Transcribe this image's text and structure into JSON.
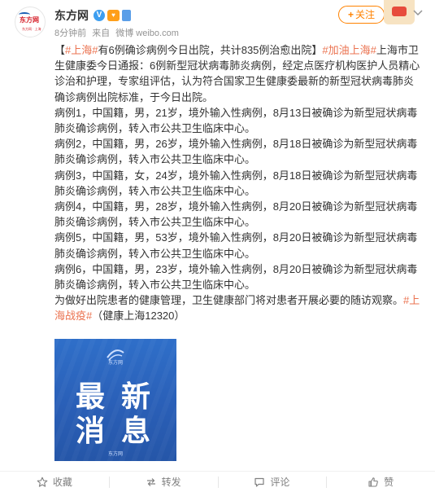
{
  "header": {
    "user_name": "东方网",
    "logo_text": "东方网",
    "logo_sub": "东方网 · 上海",
    "verified_glyph": "V",
    "timestamp": "8分钟前",
    "source_prefix": "来自",
    "source": "微博 weibo.com",
    "follow_label": "关注",
    "more_icon": "chevron-down-icon"
  },
  "post": {
    "paragraphs": [
      {
        "parts": [
          {
            "text": "【",
            "type": "text"
          },
          {
            "text": "#上海#",
            "type": "hashtag"
          },
          {
            "text": "有6例确诊病例今日出院，共计835例治愈出院】",
            "type": "text"
          },
          {
            "text": "#加油上海#",
            "type": "hashtag"
          },
          {
            "text": "上海市卫生健康委今日通报：6例新型冠状病毒肺炎病例，经定点医疗机构医护人员精心诊治和护理，专家组评估，认为符合国家卫生健康委最新的新型冠状病毒肺炎确诊病例出院标准，于今日出院。",
            "type": "text"
          }
        ]
      },
      {
        "parts": [
          {
            "text": "病例1，中国籍，男，21岁，境外输入性病例，8月13日被确诊为新型冠状病毒肺炎确诊病例，转入市公共卫生临床中心。",
            "type": "text"
          }
        ]
      },
      {
        "parts": [
          {
            "text": "病例2，中国籍，男，26岁，境外输入性病例，8月18日被确诊为新型冠状病毒肺炎确诊病例，转入市公共卫生临床中心。",
            "type": "text"
          }
        ]
      },
      {
        "parts": [
          {
            "text": "病例3，中国籍，女，24岁，境外输入性病例，8月18日被确诊为新型冠状病毒肺炎确诊病例，转入市公共卫生临床中心。",
            "type": "text"
          }
        ]
      },
      {
        "parts": [
          {
            "text": "病例4，中国籍，男，28岁，境外输入性病例，8月20日被确诊为新型冠状病毒肺炎确诊病例，转入市公共卫生临床中心。",
            "type": "text"
          }
        ]
      },
      {
        "parts": [
          {
            "text": "病例5，中国籍，男，53岁，境外输入性病例，8月20日被确诊为新型冠状病毒肺炎确诊病例，转入市公共卫生临床中心。",
            "type": "text"
          }
        ]
      },
      {
        "parts": [
          {
            "text": "病例6，中国籍，男，23岁，境外输入性病例，8月20日被确诊为新型冠状病毒肺炎确诊病例，转入市公共卫生临床中心。",
            "type": "text"
          }
        ]
      },
      {
        "parts": [
          {
            "text": "为做好出院患者的健康管理，卫生健康部门将对患者开展必要的随访观察。",
            "type": "text"
          },
          {
            "text": "#上海战疫#",
            "type": "hashtag"
          },
          {
            "text": "（健康上海12320）",
            "type": "text"
          }
        ]
      }
    ]
  },
  "image": {
    "chars": [
      "最",
      "新",
      "消",
      "息"
    ],
    "logo_text": "东方网",
    "footer": "东方网"
  },
  "actions": [
    {
      "label": "收藏",
      "icon": "star-icon",
      "name": "favorite-button"
    },
    {
      "label": "转发",
      "icon": "repost-icon",
      "name": "repost-button"
    },
    {
      "label": "评论",
      "icon": "comment-icon",
      "name": "comment-button"
    },
    {
      "label": "赞",
      "icon": "thumbs-up-icon",
      "name": "like-button"
    }
  ],
  "colors": {
    "hashtag": "#eb7350",
    "follow": "#ff8200",
    "image_bg": "#2f6fc9"
  }
}
